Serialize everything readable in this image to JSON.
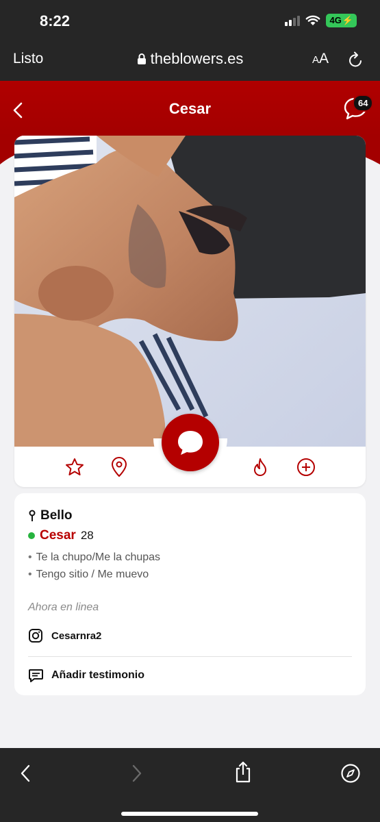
{
  "status_bar": {
    "time": "8:22",
    "network": "4G"
  },
  "browser": {
    "done_label": "Listo",
    "url": "theblowers.es",
    "aa_label": "A",
    "aa_label_big": "A"
  },
  "header": {
    "title": "Cesar",
    "chat_badge": "64"
  },
  "profile": {
    "location": "Bello",
    "name": "Cesar",
    "age": "28",
    "tags": [
      "Te la chupo/Me la chupas",
      "Tengo sitio / Me muevo"
    ],
    "status_text": "Ahora en linea",
    "instagram": "Cesarnra2",
    "add_testimonial_label": "Añadir testimonio"
  },
  "colors": {
    "brand": "#b00000",
    "online": "#27b33f",
    "browser_chrome": "#262626"
  },
  "icons": [
    "star-icon",
    "map-pin-icon",
    "chat-bubble-icon",
    "flame-icon",
    "plus-circle-icon",
    "instagram-icon",
    "message-square-icon"
  ]
}
